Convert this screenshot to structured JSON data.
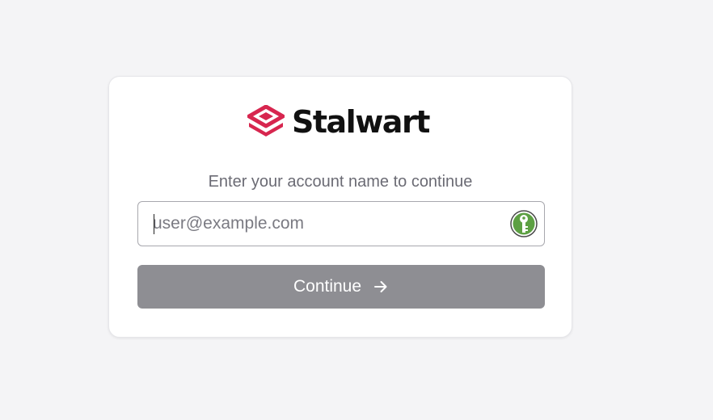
{
  "brand": {
    "name": "Stalwart",
    "logo_icon": "stalwart-logo-icon",
    "accent_color": "#d7264f"
  },
  "login": {
    "prompt": "Enter your account name to continue",
    "account_input": {
      "placeholder": "user@example.com",
      "value": ""
    },
    "password_manager_icon": "keepassxc-icon",
    "continue_label": "Continue",
    "continue_icon": "arrow-right-icon",
    "button_color": "#8e8e93"
  }
}
